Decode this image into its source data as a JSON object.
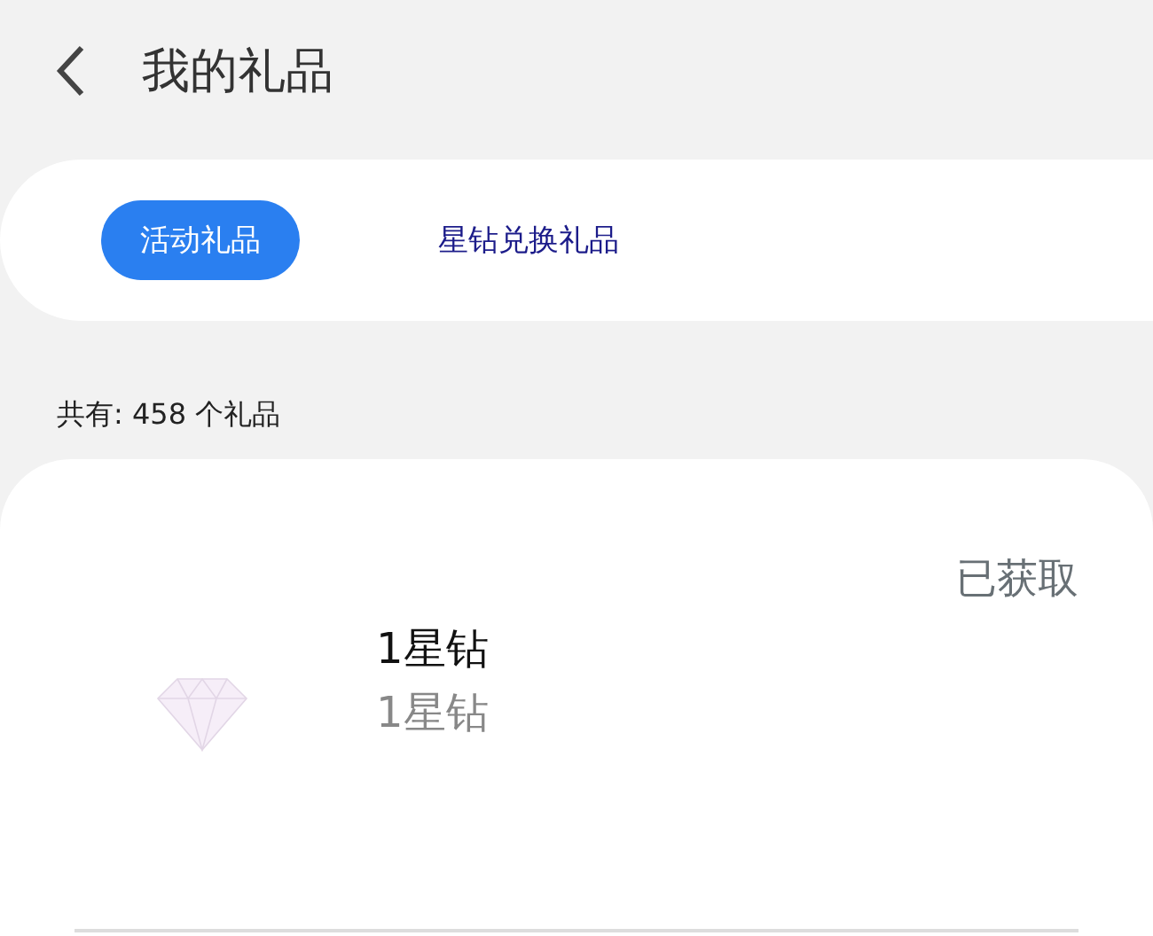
{
  "header": {
    "title": "我的礼品"
  },
  "tabs": [
    {
      "label": "活动礼品",
      "selected": true
    },
    {
      "label": "星钻兑换礼品",
      "selected": false
    }
  ],
  "summary": "共有: 458 个礼品",
  "gifts": [
    {
      "status": "已获取",
      "name": "1星钻",
      "detail": "1星钻"
    }
  ]
}
